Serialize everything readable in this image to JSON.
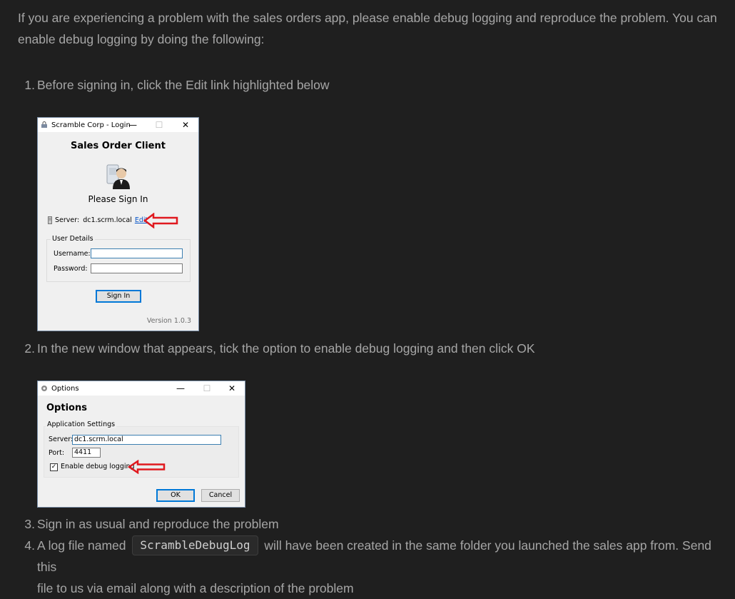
{
  "intro": "If you are experiencing a problem with the sales orders app, please enable debug logging and reproduce the problem. You can enable debug logging by doing the following:",
  "steps": [
    {
      "num": "1.",
      "text": "Before signing in, click the Edit link highlighted below"
    },
    {
      "num": "2.",
      "text": "In the new window that appears, tick the option to enable debug logging and then click OK"
    },
    {
      "num": "3.",
      "text": "Sign in as usual and reproduce the problem"
    },
    {
      "num": "4.",
      "text_before": "A log file named",
      "code": "ScrambleDebugLog",
      "text_after": "will have been created in the same folder you launched the sales app from. Send this",
      "text_line2": "file to us via email along with a description of the problem"
    }
  ],
  "login_window": {
    "title": "Scramble Corp - Login",
    "heading": "Sales Order Client",
    "subheading": "Please Sign In",
    "server_label": "Server:",
    "server_value": "dc1.scrm.local",
    "edit_link": "Edit",
    "group_label": "User Details",
    "username_label": "Username:",
    "password_label": "Password:",
    "username_value": "",
    "password_value": "",
    "sign_in_button": "Sign In",
    "version": "Version 1.0.3",
    "minimize": "—",
    "maximize": "☐",
    "close": "✕"
  },
  "options_window": {
    "title": "Options",
    "heading": "Options",
    "group_label": "Application Settings",
    "server_label": "Server:",
    "server_value": "dc1.scrm.local",
    "port_label": "Port:",
    "port_value": "4411",
    "debug_label": "Enable debug logging",
    "debug_checked": true,
    "check_mark": "✓",
    "ok_button": "OK",
    "cancel_button": "Cancel",
    "minimize": "—",
    "maximize": "☐",
    "close": "✕"
  },
  "colors": {
    "page_bg": "#1f1f1f",
    "text": "#a6a6a6",
    "highlight_arrow": "#e0191f",
    "link": "#0a57c9"
  }
}
